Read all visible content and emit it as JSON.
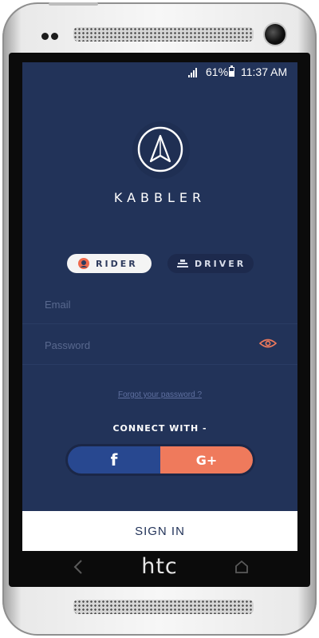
{
  "status_bar": {
    "battery": "61%",
    "time": "11:37 AM"
  },
  "brand": {
    "name": "KABBLER"
  },
  "roles": {
    "rider": "RIDER",
    "driver": "DRIVER",
    "selected": "rider"
  },
  "form": {
    "email_placeholder": "Email",
    "email_value": "",
    "password_placeholder": "Password",
    "password_value": ""
  },
  "forgot_password": "Forgot your password ?",
  "connect_label": "CONNECT WITH -",
  "social": {
    "facebook": "f",
    "google": "G+"
  },
  "signin_label": "SIGN IN",
  "device": {
    "logo": "htc"
  },
  "colors": {
    "screen_bg": "#223359",
    "facebook": "#284890",
    "google": "#ef7a5c",
    "accent": "#ef7a5c"
  },
  "icons": [
    "signal-icon",
    "battery-icon",
    "navigation-arrow-icon",
    "rider-icon",
    "driver-icon",
    "eye-icon",
    "back-key-icon",
    "home-key-icon"
  ]
}
